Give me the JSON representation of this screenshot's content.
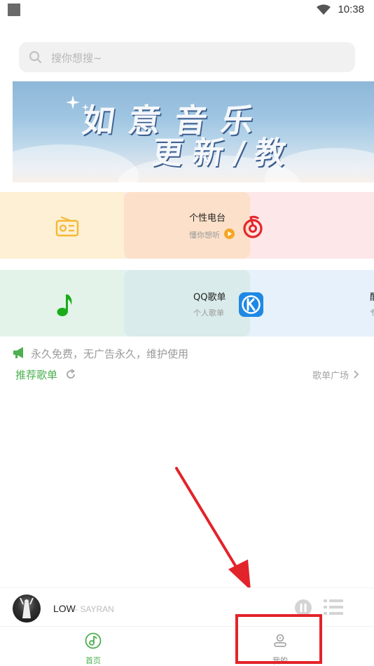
{
  "status_bar": {
    "time": "10:38"
  },
  "search": {
    "placeholder": "搜你想搜~"
  },
  "banner": {
    "line1": "如意音乐",
    "line2": "更新/教"
  },
  "cards": {
    "row1": [
      {
        "icon": "radio-icon",
        "color": "#f5b836"
      },
      {
        "title": "个性电台",
        "subtitle": "懂你想听",
        "color": "#f5a623"
      },
      {
        "icon": "netease-icon",
        "color": "#e5252a"
      }
    ],
    "row2": [
      {
        "icon": "music-note-icon",
        "color": "#1aad19"
      },
      {
        "title": "QQ歌单",
        "subtitle": "个人歌单"
      },
      {
        "icon": "kugou-icon",
        "color": "#1e88e5"
      },
      {
        "title_partial": "酷",
        "subtitle_partial": "专"
      }
    ]
  },
  "notice": {
    "text": "永久免费，无广告永久，维护使用"
  },
  "recommend": {
    "title": "推荐歌单",
    "more": "歌单广场"
  },
  "player": {
    "song": "LOW",
    "artist": "- SAYRAN"
  },
  "tabs": [
    {
      "label": "首页",
      "active": true,
      "color": "#4caf50"
    },
    {
      "label": "我的",
      "active": false,
      "color": "#888888"
    }
  ],
  "annotation_color": "#e3232a"
}
